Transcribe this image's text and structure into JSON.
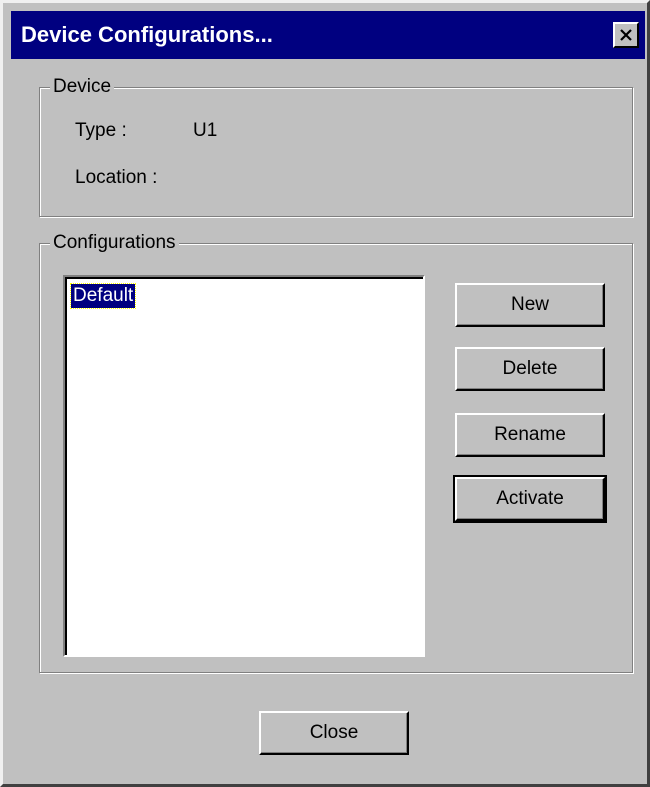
{
  "window": {
    "title": "Device Configurations..."
  },
  "device": {
    "group_label": "Device",
    "type_label": "Type :",
    "type_value": "U1",
    "location_label": "Location :",
    "location_value": ""
  },
  "configurations": {
    "group_label": "Configurations",
    "items": [
      {
        "label": "Default",
        "selected": true
      }
    ],
    "buttons": {
      "new": "New",
      "delete": "Delete",
      "rename": "Rename",
      "activate": "Activate"
    }
  },
  "footer": {
    "close_label": "Close"
  },
  "colors": {
    "titlebar": "#000080",
    "face": "#c0c0c0",
    "selection": "#000080"
  },
  "icons": {
    "close": "close-icon"
  }
}
